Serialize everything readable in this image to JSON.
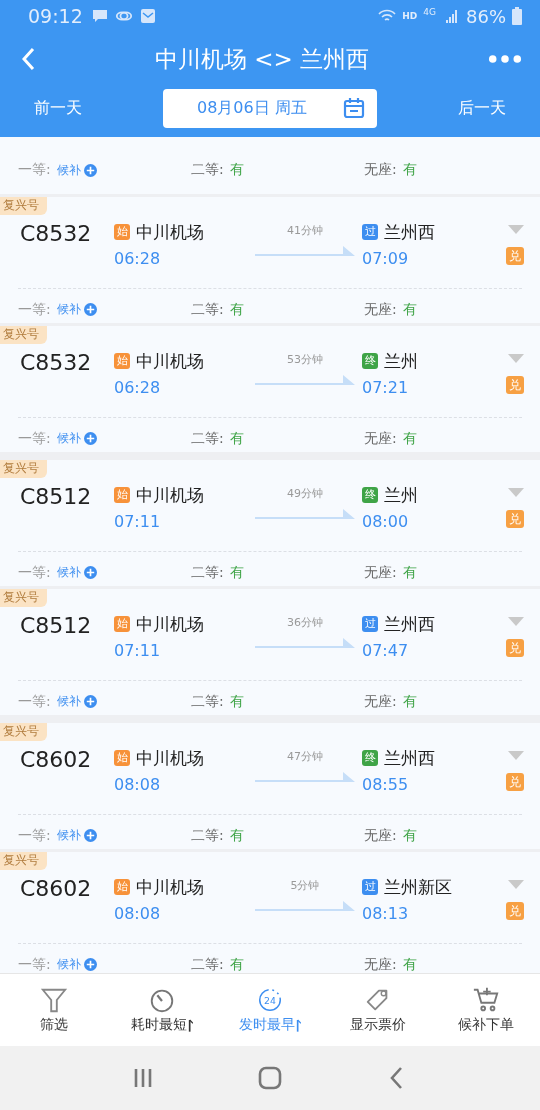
{
  "status_bar": {
    "time": "09:12",
    "hd": "HD",
    "network": "4G",
    "battery": "86%"
  },
  "header": {
    "title": "中川机场 <> 兰州西",
    "prev_day": "前一天",
    "date": "08月06日 周五",
    "next_day": "后一天"
  },
  "top_partial_seats": [
    {
      "label": "一等:",
      "value": "候补",
      "kind": "waitlist"
    },
    {
      "label": "二等:",
      "value": "有",
      "kind": "available"
    },
    {
      "label": "无座:",
      "value": "有",
      "kind": "available"
    }
  ],
  "groups": [
    {
      "trains": [
        {
          "type": "复兴号",
          "number": "C8532",
          "from": "中川机场",
          "from_tag": "始",
          "depart": "06:28",
          "duration": "41分钟",
          "to": "兰州西",
          "to_tag": {
            "label": "过",
            "color": "#3d8ef0"
          },
          "arrive": "07:09",
          "exchange": "兑",
          "seats": [
            {
              "label": "一等:",
              "value": "候补",
              "kind": "waitlist"
            },
            {
              "label": "二等:",
              "value": "有",
              "kind": "available"
            },
            {
              "label": "无座:",
              "value": "有",
              "kind": "available"
            }
          ]
        },
        {
          "type": "复兴号",
          "number": "C8532",
          "from": "中川机场",
          "from_tag": "始",
          "depart": "06:28",
          "duration": "53分钟",
          "to": "兰州",
          "to_tag": {
            "label": "终",
            "color": "#3fa447"
          },
          "arrive": "07:21",
          "exchange": "兑",
          "seats": [
            {
              "label": "一等:",
              "value": "候补",
              "kind": "waitlist"
            },
            {
              "label": "二等:",
              "value": "有",
              "kind": "available"
            },
            {
              "label": "无座:",
              "value": "有",
              "kind": "available"
            }
          ]
        }
      ]
    },
    {
      "trains": [
        {
          "type": "复兴号",
          "number": "C8512",
          "from": "中川机场",
          "from_tag": "始",
          "depart": "07:11",
          "duration": "49分钟",
          "to": "兰州",
          "to_tag": {
            "label": "终",
            "color": "#3fa447"
          },
          "arrive": "08:00",
          "exchange": "兑",
          "seats": [
            {
              "label": "一等:",
              "value": "候补",
              "kind": "waitlist"
            },
            {
              "label": "二等:",
              "value": "有",
              "kind": "available"
            },
            {
              "label": "无座:",
              "value": "有",
              "kind": "available"
            }
          ]
        },
        {
          "type": "复兴号",
          "number": "C8512",
          "from": "中川机场",
          "from_tag": "始",
          "depart": "07:11",
          "duration": "36分钟",
          "to": "兰州西",
          "to_tag": {
            "label": "过",
            "color": "#3d8ef0"
          },
          "arrive": "07:47",
          "exchange": "兑",
          "seats": [
            {
              "label": "一等:",
              "value": "候补",
              "kind": "waitlist"
            },
            {
              "label": "二等:",
              "value": "有",
              "kind": "available"
            },
            {
              "label": "无座:",
              "value": "有",
              "kind": "available"
            }
          ]
        }
      ]
    },
    {
      "trains": [
        {
          "type": "复兴号",
          "number": "C8602",
          "from": "中川机场",
          "from_tag": "始",
          "depart": "08:08",
          "duration": "47分钟",
          "to": "兰州西",
          "to_tag": {
            "label": "终",
            "color": "#3fa447"
          },
          "arrive": "08:55",
          "exchange": "兑",
          "seats": [
            {
              "label": "一等:",
              "value": "候补",
              "kind": "waitlist"
            },
            {
              "label": "二等:",
              "value": "有",
              "kind": "available"
            },
            {
              "label": "无座:",
              "value": "有",
              "kind": "available"
            }
          ]
        },
        {
          "type": "复兴号",
          "number": "C8602",
          "from": "中川机场",
          "from_tag": "始",
          "depart": "08:08",
          "duration": "5分钟",
          "to": "兰州新区",
          "to_tag": {
            "label": "过",
            "color": "#3d8ef0"
          },
          "arrive": "08:13",
          "exchange": "兑",
          "seats": [
            {
              "label": "一等:",
              "value": "候补",
              "kind": "waitlist"
            },
            {
              "label": "二等:",
              "value": "有",
              "kind": "available"
            },
            {
              "label": "无座:",
              "value": "有",
              "kind": "available"
            }
          ]
        }
      ]
    }
  ],
  "bottom_nav": [
    {
      "kind": "filter",
      "label": "筛选",
      "selected": false
    },
    {
      "kind": "duration",
      "label": "耗时最短",
      "selected": false
    },
    {
      "kind": "departure",
      "label": "发时最早",
      "icon_text": "24",
      "selected": true
    },
    {
      "kind": "price",
      "label": "显示票价",
      "selected": false
    },
    {
      "kind": "waitlist",
      "label": "候补下单",
      "selected": false
    }
  ]
}
